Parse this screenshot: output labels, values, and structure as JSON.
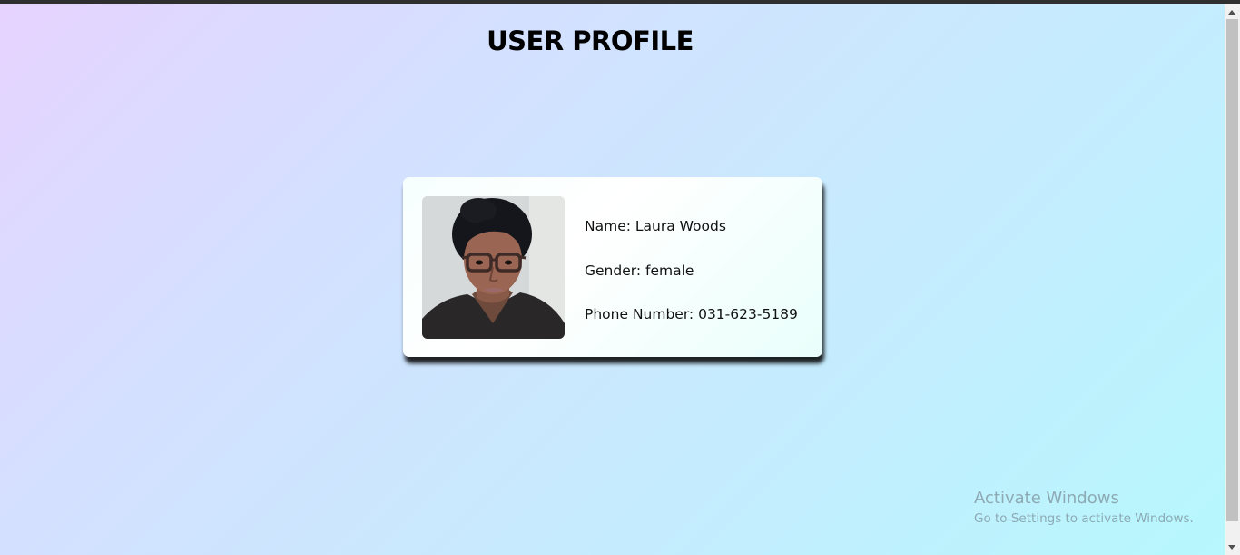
{
  "page": {
    "title": "USER PROFILE",
    "background_gradient": [
      "#e6d3ff",
      "#b7f7fd"
    ]
  },
  "profile": {
    "photo_alt": "user photo",
    "name_label": "Name: Laura Woods",
    "gender_label": "Gender: female",
    "phone_label": "Phone Number: 031-623-5189"
  },
  "watermark": {
    "title": "Activate Windows",
    "subtitle": "Go to Settings to activate Windows."
  }
}
